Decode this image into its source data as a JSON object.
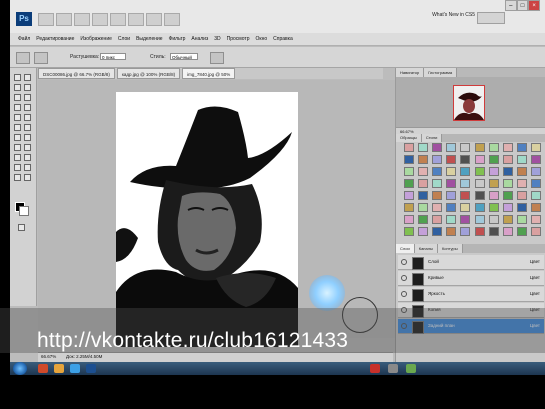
{
  "app": {
    "logo": "Ps",
    "workspace_label": "What's New in CS5",
    "window_controls": [
      "–",
      "□",
      "×"
    ]
  },
  "menu": [
    "Файл",
    "Редактирование",
    "Изображение",
    "Слои",
    "Выделение",
    "Фильтр",
    "Анализ",
    "3D",
    "Просмотр",
    "Окно",
    "Справка"
  ],
  "options_bar": {
    "feather_label": "Растушевка:",
    "feather_value": "0 пикс",
    "style_label": "Стиль:",
    "style_value": "Обычный"
  },
  "document_tabs": [
    {
      "label": "DSC00086.jpg @ 66.7% (RGB/8)",
      "active": false
    },
    {
      "label": "кадр.jpg @ 100% (RGB/8)",
      "active": false
    },
    {
      "label": "img_7840.jpg @ 50%",
      "active": true
    }
  ],
  "panels": {
    "navigator_tabs": [
      "Навигатор",
      "Гистограмма"
    ],
    "zoom_value": "66.67%",
    "swatch_tabs": [
      "Образцы",
      "Стили"
    ],
    "layer_tabs": [
      "Слои",
      "Каналы",
      "Контуры"
    ],
    "layers": [
      {
        "name": "Слой",
        "mode": "Цвет",
        "selected": false
      },
      {
        "name": "Кривые",
        "mode": "Цвет",
        "selected": false
      },
      {
        "name": "Яркость",
        "mode": "Цвет",
        "selected": false
      },
      {
        "name": "Копия",
        "mode": "Цвет",
        "selected": false
      },
      {
        "name": "Задний план",
        "mode": "Цвет",
        "selected": true
      }
    ]
  },
  "status": {
    "zoom": "66.67%",
    "doc_info": "Док: 2.25M/4.50M"
  },
  "colors": {
    "accent": "#3d8be0",
    "foreground": "#000000",
    "background": "#ffffff"
  },
  "watermark": {
    "url": "http://vkontakte.ru/club16121433"
  }
}
